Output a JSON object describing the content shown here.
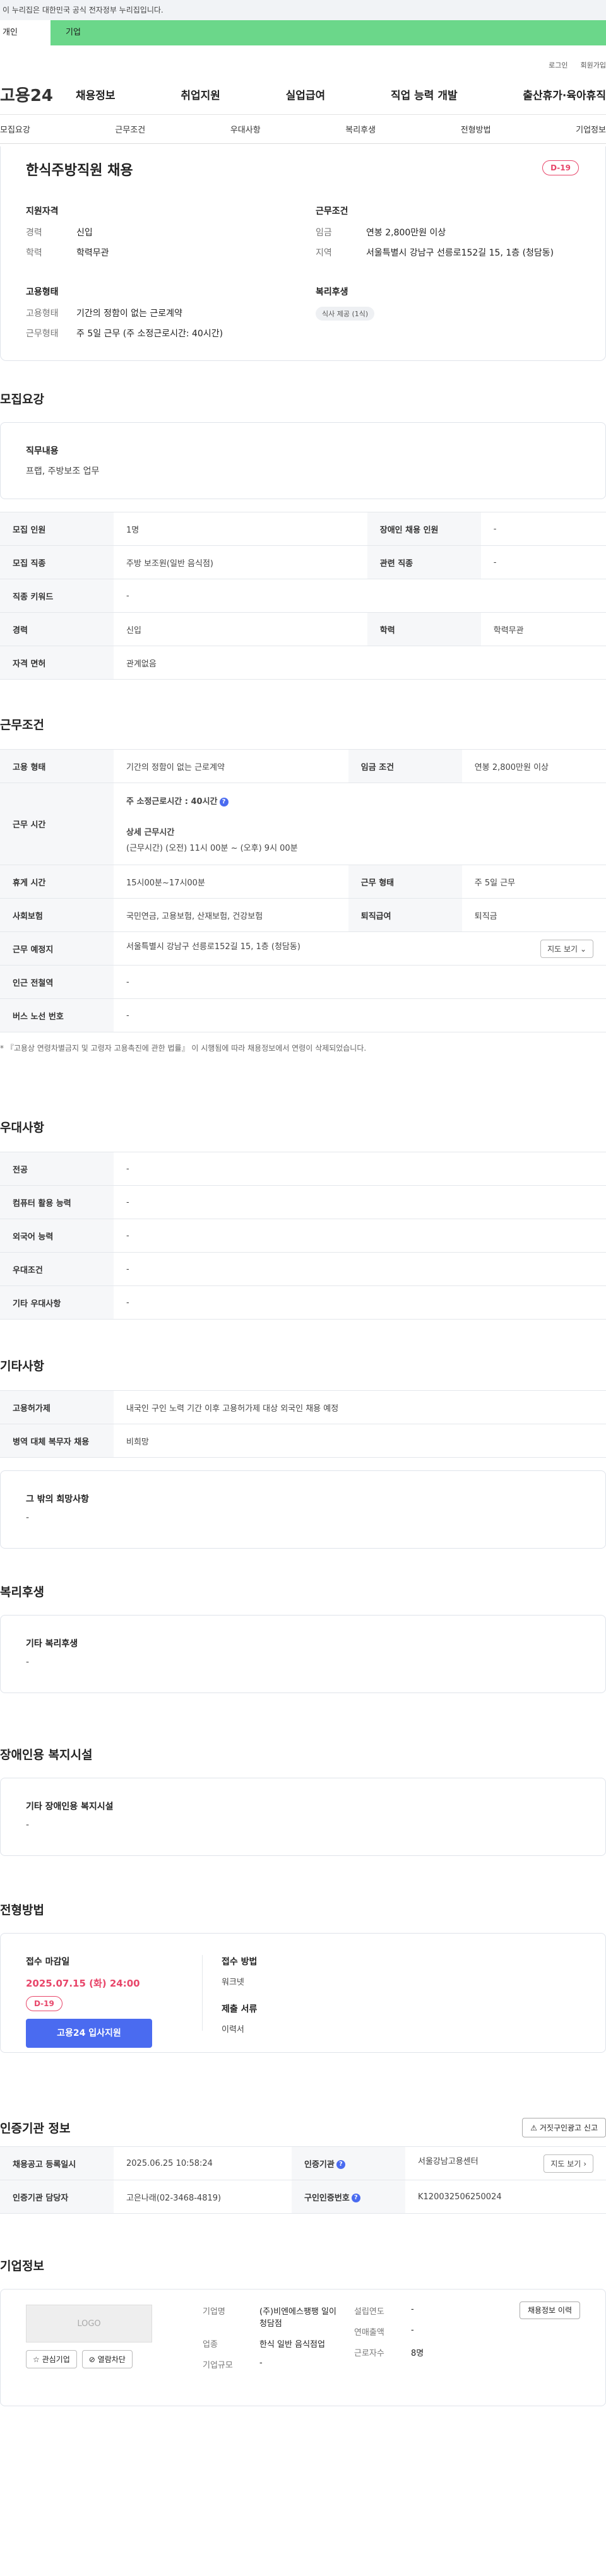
{
  "gov_bar": "이 누리집은 대한민국 공식 전자정부 누리집입니다.",
  "tabs": {
    "personal": "개인",
    "company": "기업"
  },
  "util": {
    "login": "로그인",
    "join": "회원가입"
  },
  "logo": "고용24",
  "gnb": [
    "채용정보",
    "취업지원",
    "실업급여",
    "직업 능력 개발",
    "출산휴가·육아휴직"
  ],
  "subnav": [
    "모집요강",
    "근무조건",
    "우대사항",
    "복리후생",
    "전형방법",
    "기업정보"
  ],
  "summary": {
    "title": "한식주방직원 채용",
    "dday": "D-19",
    "qual_title": "지원자격",
    "qual": [
      {
        "k": "경력",
        "v": "신입"
      },
      {
        "k": "학력",
        "v": "학력무관"
      }
    ],
    "cond_title": "근무조건",
    "cond": [
      {
        "k": "임금",
        "v": "연봉 2,800만원 이상"
      },
      {
        "k": "지역",
        "v": "서울특별시 강남구 선릉로152길 15, 1층 (청담동)"
      }
    ],
    "emp_title": "고용형태",
    "emp": [
      {
        "k": "고용형태",
        "v": "기간의 정함이 없는 근로계약"
      },
      {
        "k": "근무형태",
        "v": "주 5일 근무 (주 소정근로시간: 40시간)"
      }
    ],
    "welfare_title": "복리후생",
    "welfare_chip": "식사 제공 (1식)"
  },
  "recruit": {
    "title": "모집요강",
    "duty_title": "직무내용",
    "duty": "프랩, 주방보조 업무",
    "rows": [
      [
        "모집 인원",
        "1명",
        "장애인 채용 인원",
        "-"
      ],
      [
        "모집 직종",
        "주방 보조원(일반 음식점)",
        "관련 직종",
        "-"
      ],
      [
        "직종 키워드",
        "-",
        "",
        ""
      ],
      [
        "경력",
        "신입",
        "학력",
        "학력무관"
      ],
      [
        "자격 면허",
        "관계없음",
        "",
        ""
      ]
    ]
  },
  "work": {
    "title": "근무조건",
    "emp_type_h": "고용 형태",
    "emp_type": "기간의 정함이 없는 근로계약",
    "wage_h": "임금 조건",
    "wage": "연봉 2,800만원 이상",
    "hours_h": "근무 시간",
    "hours_main": "주 소정근로시간 : 40시간",
    "hours_detail_title": "상세 근무시간",
    "hours_detail": "(근무시간) (오전) 11시 00분 ~ (오후) 9시 00분",
    "break_h": "휴게 시간",
    "break": "15시00분~17시00분",
    "form_h": "근무 형태",
    "form": "주 5일 근무",
    "ins_h": "사회보험",
    "ins": "국민연금, 고용보험, 산재보험, 건강보험",
    "ret_h": "퇴직급여",
    "ret": "퇴직금",
    "place_h": "근무 예정지",
    "place": "서울특별시 강남구 선릉로152길 15, 1층 (청담동)",
    "map_btn": "지도 보기",
    "subway_h": "인근 전철역",
    "subway": "-",
    "bus_h": "버스 노선 번호",
    "bus": "-",
    "note": "* 『고용상 연령차별금지 및 고령자 고용촉진에 관한 법률』 이 시행됨에 따라 채용정보에서 연령이 삭제되었습니다."
  },
  "pref": {
    "title": "우대사항",
    "rows": [
      [
        "전공",
        "-"
      ],
      [
        "컴퓨터 활용 능력",
        "-"
      ],
      [
        "외국어 능력",
        "-"
      ],
      [
        "우대조건",
        "-"
      ],
      [
        "기타 우대사항",
        "-"
      ]
    ]
  },
  "etc": {
    "title": "기타사항",
    "rows": [
      [
        "고용허가제",
        "내국인 구인 노력 기간 이후 고용허가제 대상 외국인 채용 예정"
      ],
      [
        "병역 대체 복무자 채용",
        "비희망"
      ]
    ],
    "wish_title": "그 밖의 희망사항",
    "wish": "-"
  },
  "welfare": {
    "title": "복리후생",
    "box_title": "기타 복리후생",
    "box_value": "-"
  },
  "disabled": {
    "title": "장애인용 복지시설",
    "box_title": "기타 장애인용 복지시설",
    "box_value": "-"
  },
  "selection": {
    "title": "전형방법",
    "deadline_label": "접수 마감일",
    "deadline": "2025.07.15 (화) 24:00",
    "dday": "D-19",
    "apply": "고용24 입사지원",
    "method_label": "접수 방법",
    "method": "워크넷",
    "docs_label": "제출 서류",
    "docs": "이력서"
  },
  "cert": {
    "title": "인증기관 정보",
    "report_btn": "거짓구인광고 신고",
    "reg_h": "채용공고 등록일시",
    "reg": "2025.06.25 10:58:24",
    "org_h": "인증기관",
    "org": "서울강남고용센터",
    "map_btn": "지도 보기",
    "mgr_h": "인증기관 담당자",
    "mgr": "고은나래(02-3468-4819)",
    "no_h": "구인인증번호",
    "no": "K120032506250024"
  },
  "company": {
    "title": "기업정보",
    "logo": "LOGO",
    "fav_btn": "관심기업",
    "block_btn": "열람차단",
    "history_btn": "채용정보 이력",
    "name_k": "기업명",
    "name": "(주)비엔에스팽팽 일이청담점",
    "industry_k": "업종",
    "industry": "한식 일반 음식점업",
    "size_k": "기업규모",
    "size": "-",
    "found_k": "설립연도",
    "found": "-",
    "sales_k": "연매출액",
    "sales": "-",
    "staff_k": "근로자수",
    "staff": "8명"
  }
}
